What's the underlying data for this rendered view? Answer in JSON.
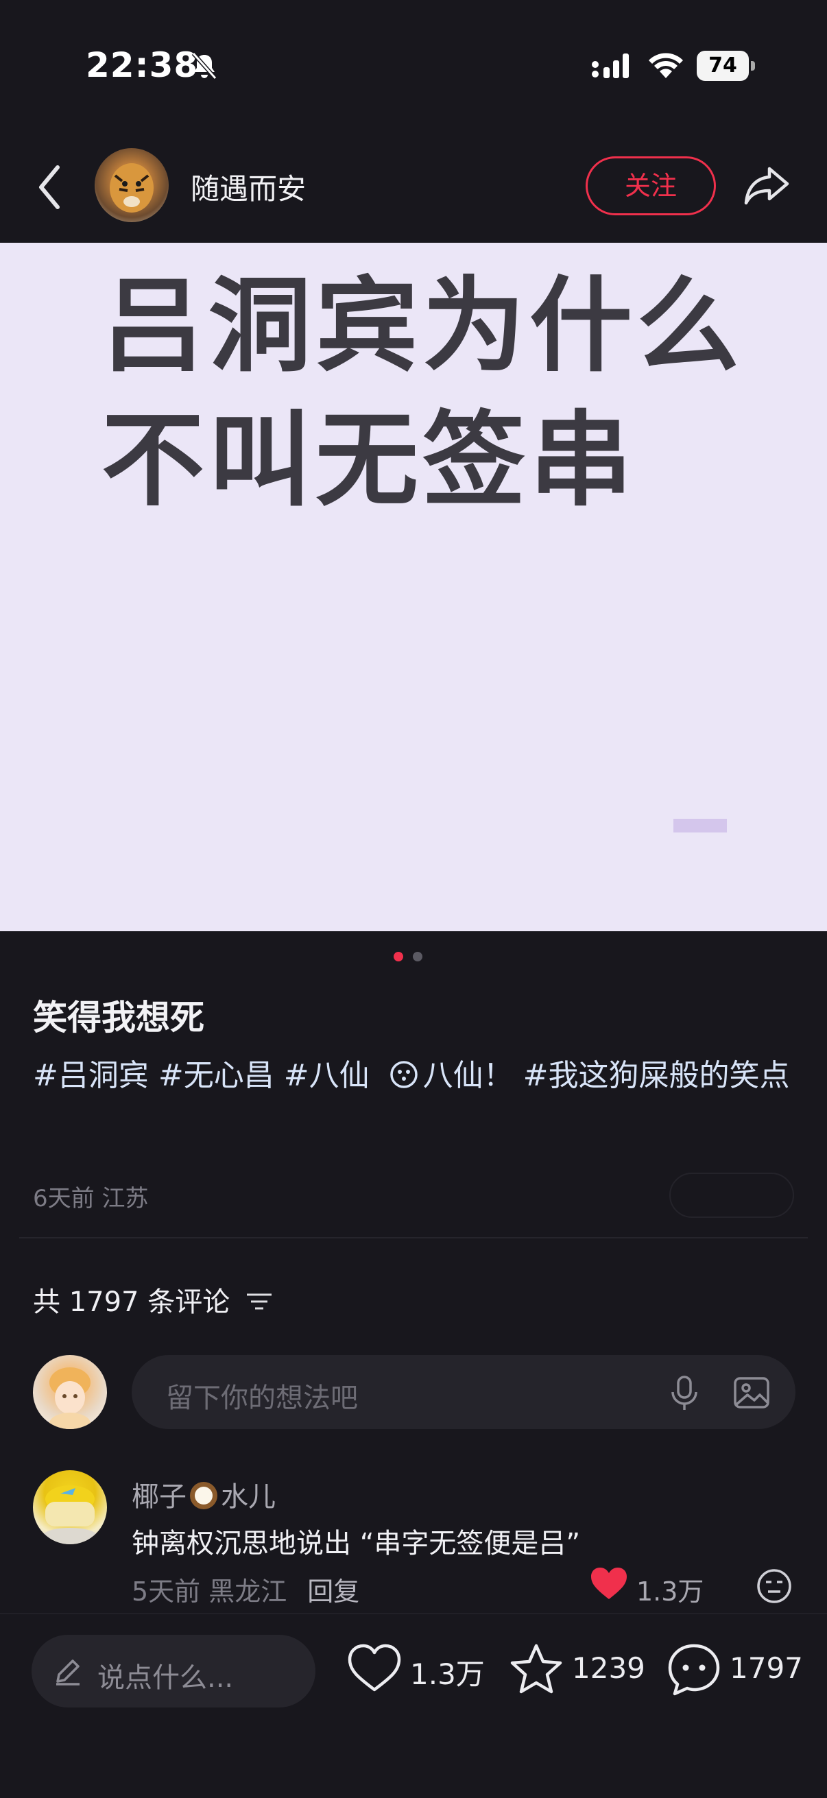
{
  "status_bar": {
    "time": "22:38",
    "icons": [
      "bell-muted-icon",
      "cellular-signal-icon",
      "wifi-icon",
      "battery-icon"
    ],
    "battery": "74"
  },
  "header": {
    "username": "随遇而安",
    "follow_label": "关注",
    "icons": [
      "back-icon",
      "share-icon"
    ]
  },
  "image": {
    "line1": "吕洞宾为什么",
    "line2": "不叫无签串",
    "background": "#ebe6f7"
  },
  "post": {
    "title": "笑得我想死",
    "tag1": "#吕洞宾",
    "tag2": "#无心昌",
    "tag3": "#八仙",
    "topic": "八仙！",
    "tag4": "#我这狗屎般的笑点",
    "time_location": "6天前 江苏"
  },
  "comments": {
    "count_label": "共 1797 条评论",
    "input_placeholder": "留下你的想法吧",
    "items": [
      {
        "name_part1": "椰子",
        "name_part2": "水儿",
        "text": "钟离权沉思地说出 “串字无签便是吕”",
        "meta": "5天前 黑龙江",
        "reply": "回复",
        "likes": "1.3万"
      }
    ]
  },
  "bottom_bar": {
    "placeholder": "说点什么...",
    "likes": "1.3万",
    "stars": "1239",
    "comments": "1797"
  },
  "colors": {
    "accent": "#f0304c",
    "background": "#18171d"
  }
}
